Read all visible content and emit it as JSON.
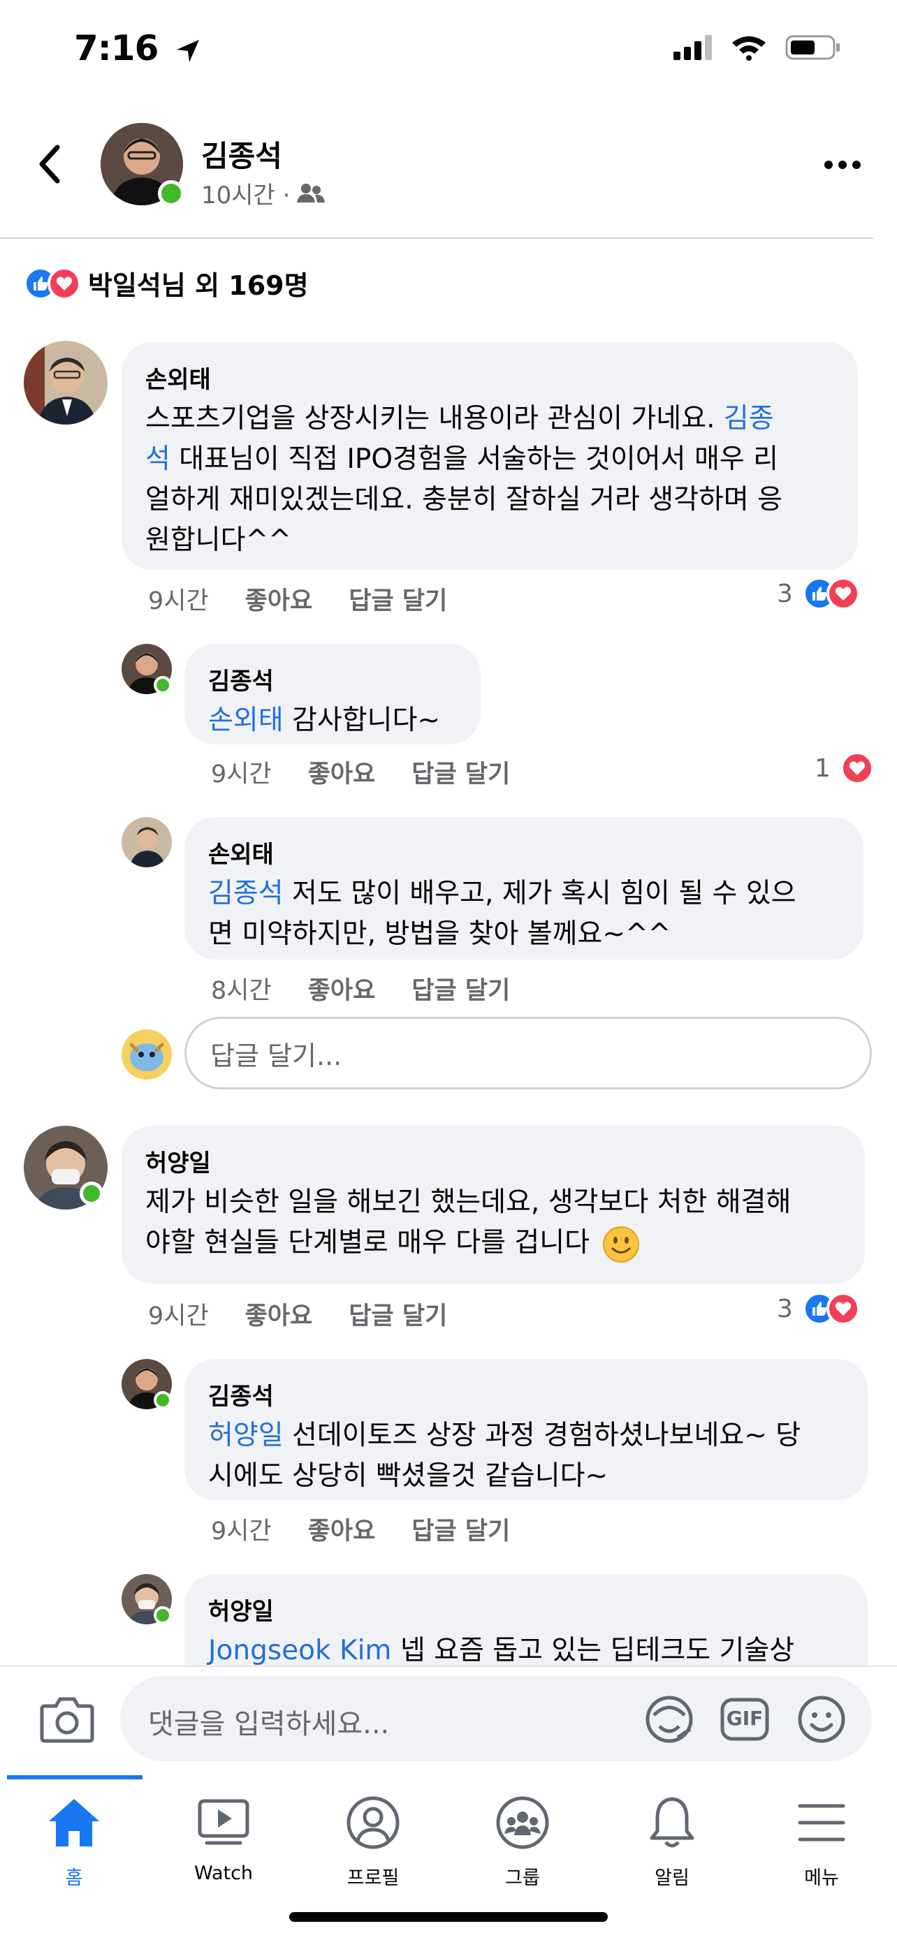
{
  "status_bar": {
    "time": "7:16"
  },
  "header": {
    "name": "김종석",
    "meta": "10시간 ·"
  },
  "reactions": {
    "text": "박일석님 외 169명"
  },
  "comments": [
    {
      "author": "손외태",
      "mention": "김종\n석",
      "text": "스포츠기업을 상장시키는 내용이라 관심이 가네요.",
      "text2": "대표님이 직접 IPO경험을 서술하는 것이어서 매우 리\n얼하게 재미있겠는데요. 충분히 잘하실 거라 생각하며 응\n원합니다^^",
      "time": "9시간",
      "like": "좋아요",
      "reply": "답글 달기",
      "count": "3"
    },
    {
      "author": "김종석",
      "mention": "손외태",
      "text": "감사합니다~",
      "time": "9시간",
      "like": "좋아요",
      "reply": "답글 달기",
      "count": "1"
    },
    {
      "author": "손외태",
      "mention": "김종석",
      "text": "저도 많이 배우고, 제가 혹시 힘이 될 수 있으\n면 미약하지만, 방법을 찾아 볼께요~^^",
      "time": "8시간",
      "like": "좋아요",
      "reply": "답글 달기"
    },
    {
      "author": "허양일",
      "text": "제가 비슷한 일을 해보긴 했는데요, 생각보다 처한 해결해\n야할 현실들 단계별로 매우 다를 겁니다",
      "time": "9시간",
      "like": "좋아요",
      "reply": "답글 달기",
      "count": "3"
    },
    {
      "author": "김종석",
      "mention": "허양일",
      "text": "선데이토즈 상장 과정 경험하셨나보네요~ 당\n시에도 상당히 빡셨을것 같습니다~",
      "time": "9시간",
      "like": "좋아요",
      "reply": "답글 달기"
    },
    {
      "author": "허양일",
      "mention": "Jongseok Kim",
      "text": "넵 요즘 돕고 있는 딥테크도 기술상"
    }
  ],
  "reply_input": {
    "placeholder": "답글 달기..."
  },
  "composer": {
    "placeholder": "댓글을 입력하세요...",
    "gif": "GIF"
  },
  "tabs": [
    {
      "label": "홈",
      "icon": "home-icon",
      "active": true
    },
    {
      "label": "Watch",
      "icon": "watch-icon"
    },
    {
      "label": "프로필",
      "icon": "profile-icon"
    },
    {
      "label": "그룹",
      "icon": "groups-icon"
    },
    {
      "label": "알림",
      "icon": "bell-icon"
    },
    {
      "label": "메뉴",
      "icon": "menu-icon"
    }
  ],
  "colors": {
    "accent": "#1877f2",
    "mention": "#216fdb",
    "love": "#f33e58",
    "online": "#42b72a"
  }
}
